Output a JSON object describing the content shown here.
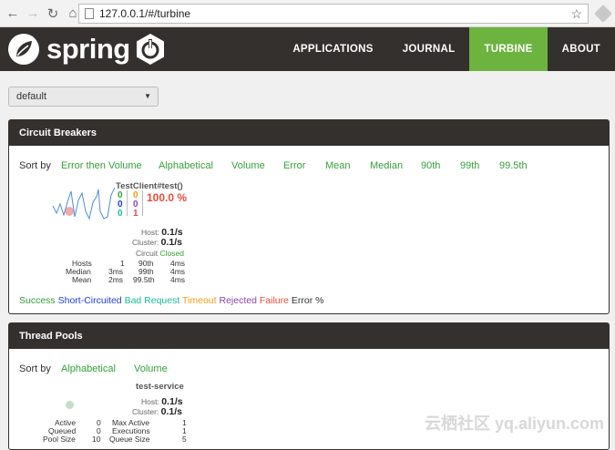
{
  "browser": {
    "url": "127.0.0.1/#/turbine"
  },
  "brand": {
    "name": "spring"
  },
  "nav": {
    "items": [
      {
        "label": "APPLICATIONS",
        "active": false
      },
      {
        "label": "JOURNAL",
        "active": false
      },
      {
        "label": "TURBINE",
        "active": true
      },
      {
        "label": "ABOUT",
        "active": false
      }
    ]
  },
  "cluster_select": {
    "value": "default"
  },
  "circuit_breakers": {
    "title": "Circuit Breakers",
    "sort_label": "Sort by",
    "sort_options": [
      "Error then Volume",
      "Alphabetical",
      "Volume",
      "Error",
      "Mean",
      "Median",
      "90th",
      "99th",
      "99.5th"
    ],
    "card": {
      "name": "TestClient#test()",
      "counts_col1": [
        "0",
        "0",
        "0"
      ],
      "counts_col2": [
        "0",
        "0",
        "1"
      ],
      "error_pct": "100.0 %",
      "host_label": "Host:",
      "host_value": "0.1/s",
      "cluster_label": "Cluster:",
      "cluster_value": "0.1/s",
      "circuit_label": "Circuit",
      "circuit_value": "Closed",
      "hosts_label": "Hosts",
      "hosts_value": "1",
      "median_label": "Median",
      "median_value": "3ms",
      "mean_label": "Mean",
      "mean_value": "2ms",
      "p90_label": "90th",
      "p90_value": "4ms",
      "p99_label": "99th",
      "p99_value": "4ms",
      "p995_label": "99.5th",
      "p995_value": "4ms"
    },
    "legend": {
      "success": "Success",
      "short_circuited": "Short-Circuited",
      "bad_request": "Bad Request",
      "timeout": "Timeout",
      "rejected": "Rejected",
      "failure": "Failure",
      "error_pct": "Error %"
    }
  },
  "thread_pools": {
    "title": "Thread Pools",
    "sort_label": "Sort by",
    "sort_options": [
      "Alphabetical",
      "Volume"
    ],
    "card": {
      "name": "test-service",
      "host_label": "Host:",
      "host_value": "0.1/s",
      "cluster_label": "Cluster:",
      "cluster_value": "0.1/s",
      "active_label": "Active",
      "active_value": "0",
      "queued_label": "Queued",
      "queued_value": "0",
      "pool_size_label": "Pool Size",
      "pool_size_value": "10",
      "max_active_label": "Max Active",
      "max_active_value": "1",
      "executions_label": "Executions",
      "executions_value": "1",
      "queue_size_label": "Queue Size",
      "queue_size_value": "5"
    }
  },
  "watermark": "云栖社区 yq.aliyun.com",
  "colors": {
    "nav_bg": "#34302d",
    "accent": "#6db33f",
    "link": "#34a03a",
    "success": "#34a03a",
    "short_circuited": "#1f3bd6",
    "bad_request": "#1abc9c",
    "timeout": "#f39c12",
    "rejected": "#8e44ad",
    "failure": "#e74c3c"
  }
}
